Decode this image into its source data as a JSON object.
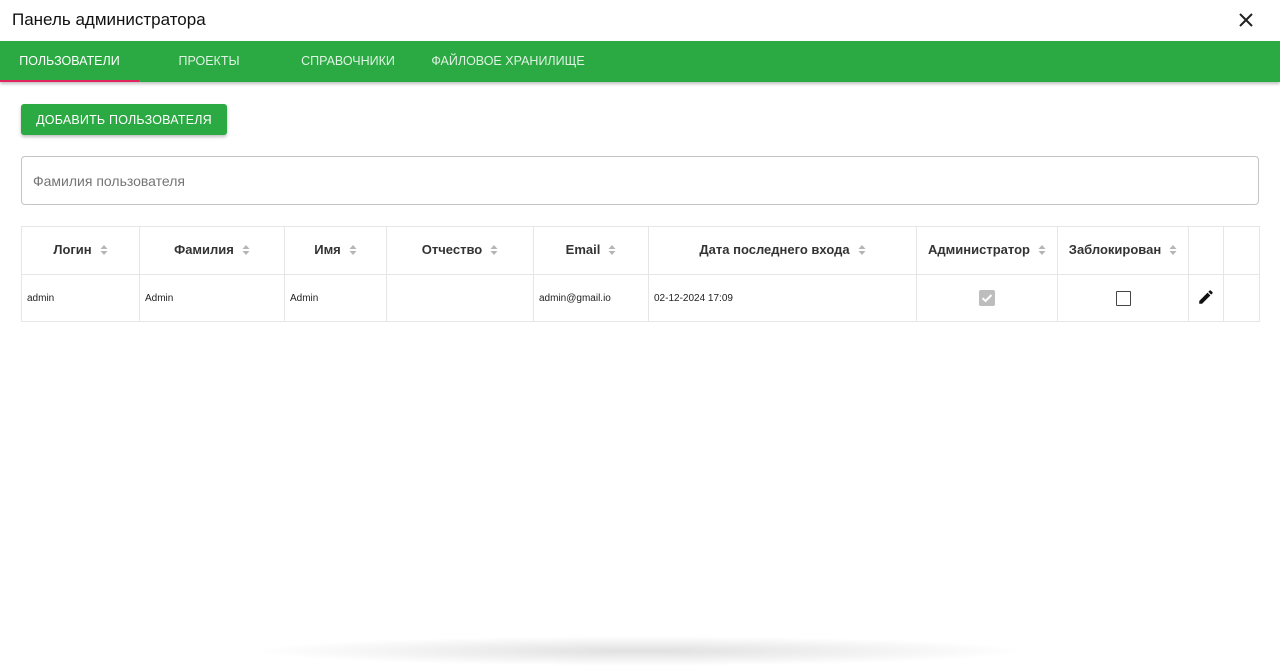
{
  "window": {
    "title": "Панель администратора",
    "close_icon": "close-icon"
  },
  "tabs": [
    {
      "label": "Пользователи",
      "active": true
    },
    {
      "label": "Проекты",
      "active": false
    },
    {
      "label": "Справочники",
      "active": false
    },
    {
      "label": "Файловое хранилище",
      "active": false
    }
  ],
  "toolbar": {
    "add_user_label": "Добавить пользователя"
  },
  "search": {
    "placeholder": "Фамилия пользователя",
    "value": ""
  },
  "table": {
    "columns": [
      "Логин",
      "Фамилия",
      "Имя",
      "Отчество",
      "Email",
      "Дата последнего входа",
      "Администратор",
      "Заблокирован"
    ],
    "rows": [
      {
        "login": "admin",
        "last_name": "Admin",
        "first_name": "Admin",
        "patronymic": "",
        "email": "admin@gmail.io",
        "last_login": "02-12-2024 17:09",
        "is_admin": true,
        "is_blocked": false
      }
    ]
  },
  "colors": {
    "accent": "#2ba942",
    "tab_indicator": "#e0245e"
  }
}
